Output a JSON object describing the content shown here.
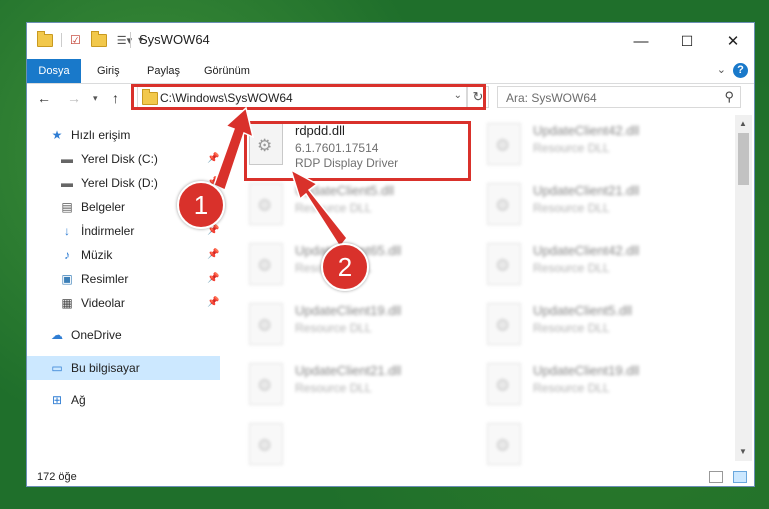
{
  "window": {
    "title": "SysWOW64",
    "controls": {
      "minimize": "—",
      "maximize": "☐",
      "close": "✕"
    }
  },
  "ribbon": {
    "tabs": [
      "Dosya",
      "Giriş",
      "Paylaş",
      "Görünüm"
    ],
    "help": "?"
  },
  "navigation": {
    "address": "C:\\Windows\\SysWOW64",
    "search_placeholder": "Ara: SysWOW64"
  },
  "sidebar": {
    "items": [
      {
        "label": "Hızlı erişim",
        "icon": "star-icon"
      },
      {
        "label": "Yerel Disk (C:)",
        "icon": "drive-icon"
      },
      {
        "label": "Yerel Disk (D:)",
        "icon": "drive-icon"
      },
      {
        "label": "Belgeler",
        "icon": "document-icon"
      },
      {
        "label": "İndirmeler",
        "icon": "download-icon"
      },
      {
        "label": "Müzik",
        "icon": "music-icon"
      },
      {
        "label": "Resimler",
        "icon": "pictures-icon"
      },
      {
        "label": "Videolar",
        "icon": "video-icon"
      },
      {
        "label": "OneDrive",
        "icon": "cloud-icon"
      },
      {
        "label": "Bu bilgisayar",
        "icon": "computer-icon"
      },
      {
        "label": "Ağ",
        "icon": "network-icon"
      }
    ]
  },
  "files": {
    "highlighted": {
      "name": "rdpdd.dll",
      "version": "6.1.7601.17514",
      "description": "RDP Display Driver"
    },
    "others": [
      {
        "name": "UpdateClient42.dll",
        "type": "Resource DLL"
      },
      {
        "name": "UpdateClient5.dll",
        "type": "Resource DLL"
      },
      {
        "name": "UpdateClient21.dll",
        "type": "Resource DLL"
      },
      {
        "name": "UpdateClient65.dll",
        "type": "Resource DLL"
      },
      {
        "name": "UpdateClient42.dll",
        "type": "Resource DLL"
      },
      {
        "name": "UpdateClient19.dll",
        "type": "Resource DLL"
      },
      {
        "name": "UpdateClient5.dll",
        "type": "Resource DLL"
      },
      {
        "name": "UpdateClient21.dll",
        "type": "Resource DLL"
      },
      {
        "name": "UpdateClient19.dll",
        "type": "Resource DLL"
      }
    ]
  },
  "status": {
    "count": "172 öğe"
  },
  "annotations": {
    "step1": "1",
    "step2": "2",
    "color": "#d9312b"
  }
}
